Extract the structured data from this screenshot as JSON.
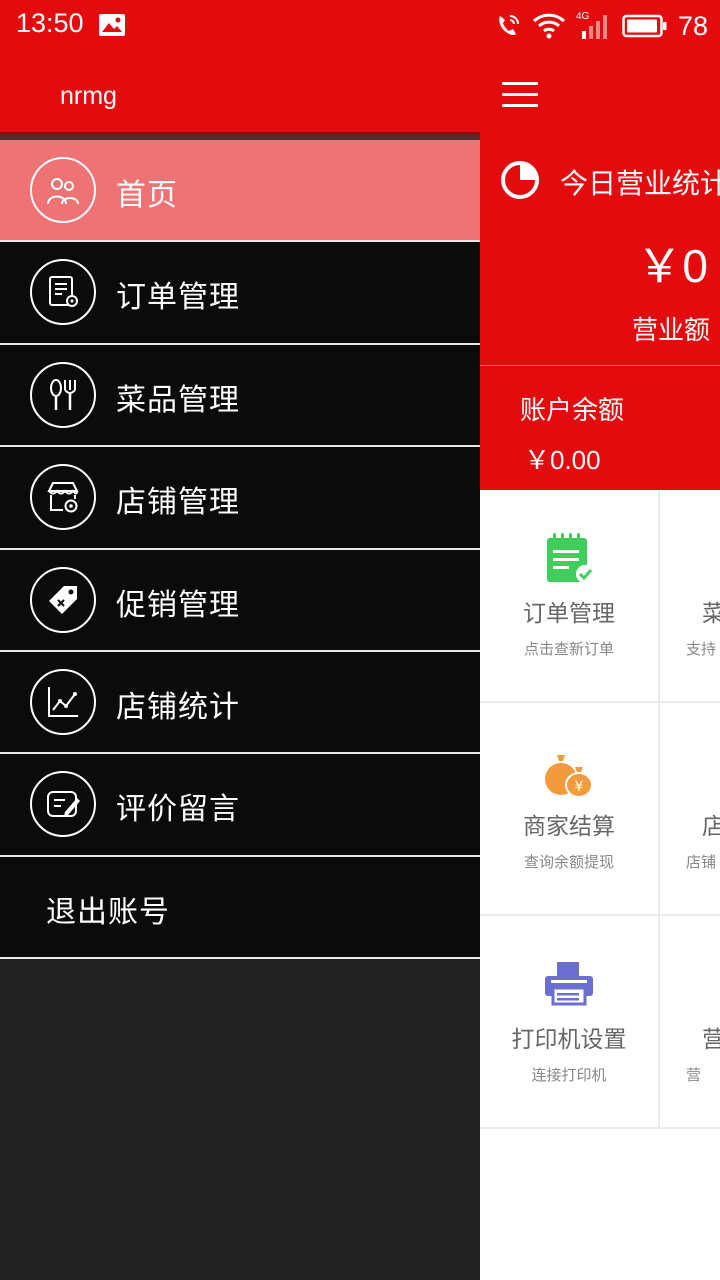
{
  "status_bar": {
    "time": "13:50",
    "battery": "78",
    "network": "4G"
  },
  "drawer": {
    "username": "nrmg",
    "items": [
      {
        "label": "首页",
        "icon": "users-icon",
        "active": true
      },
      {
        "label": "订单管理",
        "icon": "order-settings-icon",
        "active": false
      },
      {
        "label": "菜品管理",
        "icon": "utensils-icon",
        "active": false
      },
      {
        "label": "店铺管理",
        "icon": "store-settings-icon",
        "active": false
      },
      {
        "label": "促销管理",
        "icon": "tag-icon",
        "active": false
      },
      {
        "label": "店铺统计",
        "icon": "line-chart-icon",
        "active": false
      },
      {
        "label": "评价留言",
        "icon": "edit-message-icon",
        "active": false
      },
      {
        "label": "退出账号",
        "icon": "",
        "active": false
      }
    ]
  },
  "main": {
    "today_title": "今日营业统计",
    "revenue_value": "￥0",
    "revenue_label": "营业额",
    "balance_label": "账户余额",
    "balance_value": "￥0.00",
    "grid": [
      [
        {
          "title": "订单管理",
          "subtitle": "点击查新订单",
          "icon": "clipboard-check-icon",
          "color": "#3fce5c"
        },
        {
          "title": "菜",
          "subtitle": "支持",
          "icon": "",
          "color": "#666666"
        }
      ],
      [
        {
          "title": "商家结算",
          "subtitle": "查询余额提现",
          "icon": "money-bag-icon",
          "color": "#f29a3e"
        },
        {
          "title": "店",
          "subtitle": "店铺",
          "icon": "",
          "color": "#666666"
        }
      ],
      [
        {
          "title": "打印机设置",
          "subtitle": "连接打印机",
          "icon": "printer-icon",
          "color": "#6a6fd0"
        },
        {
          "title": "营",
          "subtitle": "营",
          "icon": "",
          "color": "#666666"
        }
      ]
    ]
  },
  "colors": {
    "brand_red": "#e30b0e",
    "active_item": "#ef7274",
    "drawer_bg": "#0b0b0b"
  }
}
